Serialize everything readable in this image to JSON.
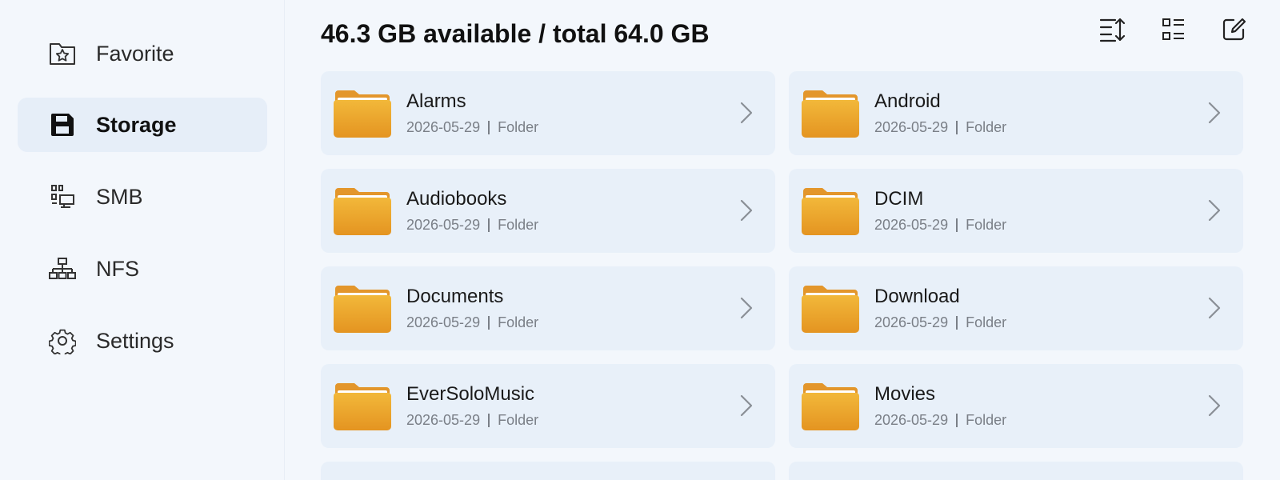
{
  "sidebar": {
    "items": [
      {
        "label": "Favorite",
        "icon": "favorite-folder-icon",
        "active": false
      },
      {
        "label": "Storage",
        "icon": "storage-icon",
        "active": true
      },
      {
        "label": "SMB",
        "icon": "smb-network-icon",
        "active": false
      },
      {
        "label": "NFS",
        "icon": "nfs-network-icon",
        "active": false
      },
      {
        "label": "Settings",
        "icon": "gear-icon",
        "active": false
      }
    ]
  },
  "header": {
    "storage_summary": "46.3 GB available / total 64.0 GB",
    "tools": [
      "sort-icon",
      "list-view-icon",
      "edit-icon"
    ]
  },
  "folders": [
    {
      "name": "Alarms",
      "date": "2026-05-29",
      "type": "Folder"
    },
    {
      "name": "Android",
      "date": "2026-05-29",
      "type": "Folder"
    },
    {
      "name": "Audiobooks",
      "date": "2026-05-29",
      "type": "Folder"
    },
    {
      "name": "DCIM",
      "date": "2026-05-29",
      "type": "Folder"
    },
    {
      "name": "Documents",
      "date": "2026-05-29",
      "type": "Folder"
    },
    {
      "name": "Download",
      "date": "2026-05-29",
      "type": "Folder"
    },
    {
      "name": "EverSoloMusic",
      "date": "2026-05-29",
      "type": "Folder"
    },
    {
      "name": "Movies",
      "date": "2026-05-29",
      "type": "Folder"
    }
  ],
  "colors": {
    "background": "#f3f7fc",
    "card": "#e8f0f9",
    "active_item": "#e6eef8",
    "folder_top": "#f2b83a",
    "folder_bottom": "#e49421"
  }
}
